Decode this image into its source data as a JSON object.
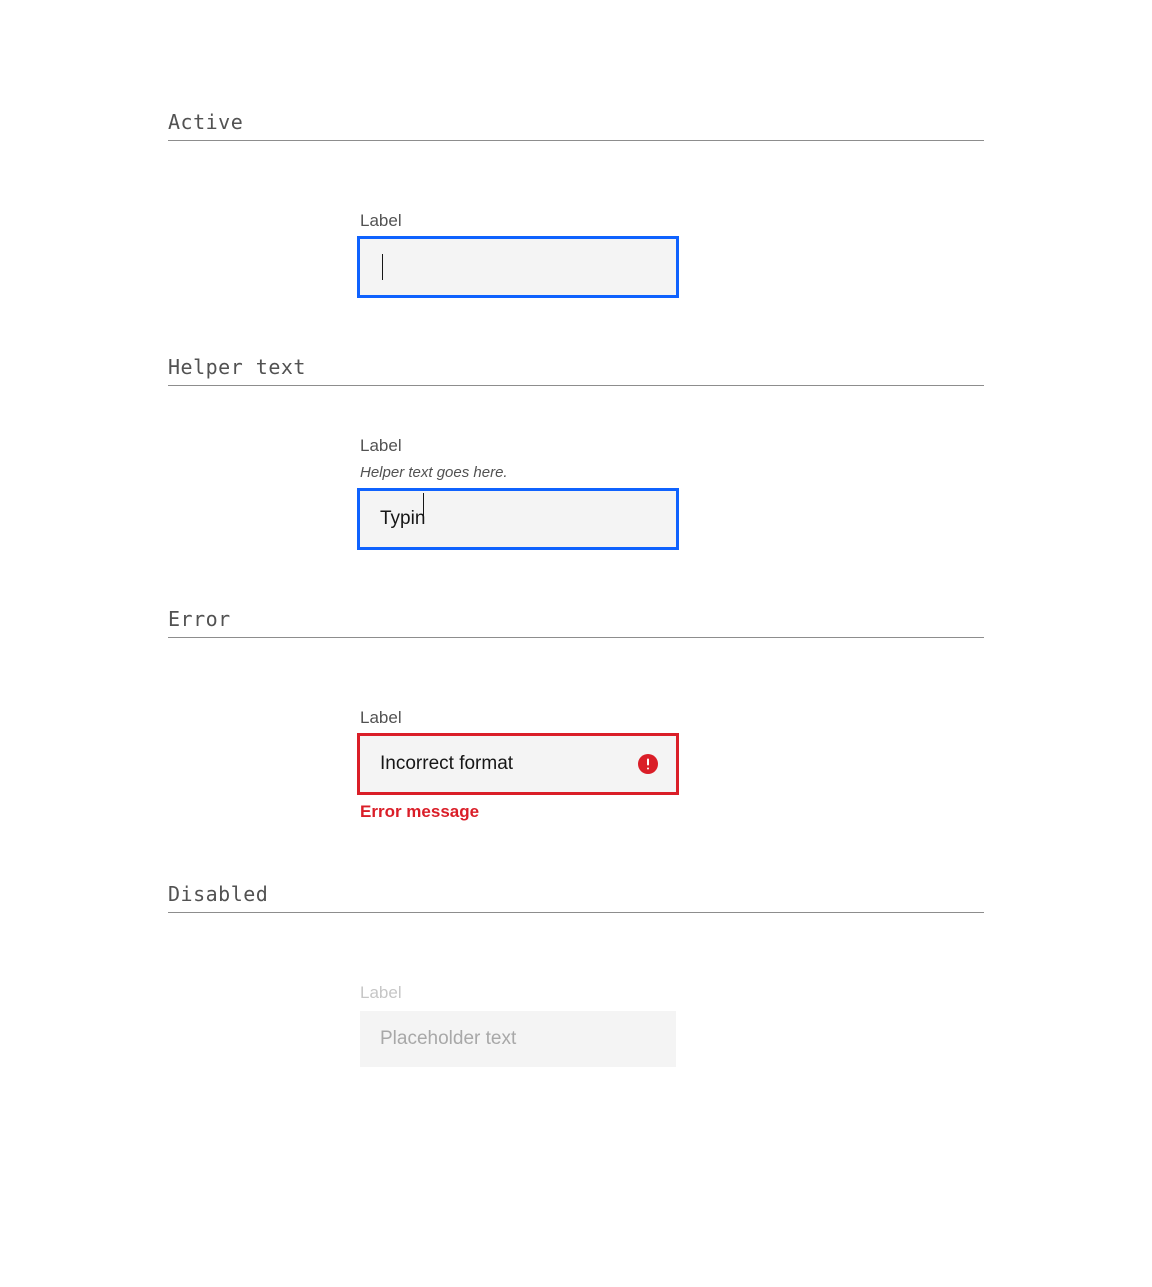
{
  "sections": {
    "active": {
      "title": "Active",
      "label": "Label",
      "value": ""
    },
    "helper": {
      "title": "Helper text",
      "label": "Label",
      "helper_text": "Helper text goes here.",
      "value": "Typin"
    },
    "error": {
      "title": "Error",
      "label": "Label",
      "value": "Incorrect format",
      "error_message": "Error message"
    },
    "disabled": {
      "title": "Disabled",
      "label": "Label",
      "placeholder": "Placeholder text"
    }
  },
  "colors": {
    "focus": "#0f62fe",
    "error": "#da1e28",
    "field_bg": "#f4f4f4",
    "text_secondary": "#525252",
    "text_disabled": "#c6c6c6"
  }
}
